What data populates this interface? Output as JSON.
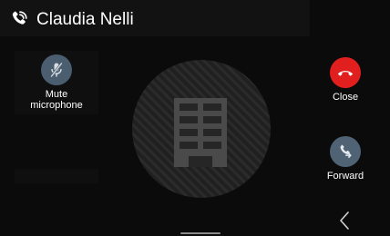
{
  "header": {
    "caller_name": "Claudia Nelli",
    "icon": "phone-ringing-icon"
  },
  "avatar": {
    "icon": "building-icon"
  },
  "actions": {
    "mute": {
      "label": "Mute\nmicrophone",
      "icon": "microphone-off-icon",
      "color": "#4a5e70"
    },
    "close": {
      "label": "Close",
      "icon": "hang-up-icon",
      "color": "#e21f1f"
    },
    "forward": {
      "label": "Forward",
      "icon": "forward-call-icon",
      "color": "#4f6375"
    }
  },
  "navigation": {
    "back_icon": "chevron-left-icon"
  }
}
